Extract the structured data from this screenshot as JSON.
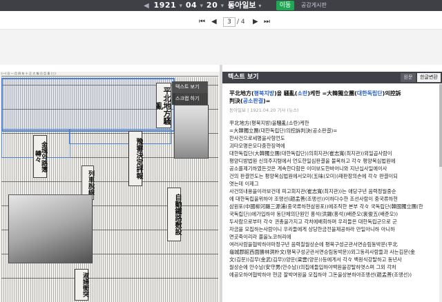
{
  "topbar": {
    "year": "1921",
    "month": "04",
    "day": "20",
    "prev_arrow": "◀",
    "next_arrow": "▶",
    "paper_name": "동아일보",
    "paper_caret": "▾",
    "go_label": "이동",
    "board_label": "공감게시판"
  },
  "pager": {
    "first": "⏮",
    "prev": "◀",
    "current": "3",
    "total": "/ 4",
    "next": "▶",
    "last": "⏭"
  },
  "scan": {
    "masthead": "(一)    日    一    月    四    年    十    正    大        報    日    亞    東        (三)",
    "headline_main": "平北地方騷亂",
    "headline_sub": "金塊와路簿轉々",
    "headline_2": "豫審決定評報",
    "headline_3": "列車脫線",
    "headline_4": "自動鐵路敷設",
    "headline_5": "淑婦衝突",
    "popup_text_view": "텍스트 보기",
    "popup_scrap": "스크랩 하기"
  },
  "textpanel": {
    "header_title": "텍스트 보기",
    "tab_original": "원문",
    "tab_hangul": "한글변환",
    "title_pre": "平北地方(",
    "title_link1": "평북지방",
    "title_mid1": ")을 騷亂(",
    "title_link2": "소란",
    "title_mid2": ")케한 =大韓獨立團(",
    "title_link3": "대한독립단",
    "title_mid3": ")의控訴",
    "title_line2_pre": "判決(",
    "title_link4": "공소판결",
    "title_post": ")=",
    "meta": "동아일보 | 1921.04.20 기사 (뉴스)",
    "body": "平北地方(평북지방)을騷亂(소란)케한\n=大韓獨立團(대한독립단)의控訴判決(공소판결)=\n한사건으로세명을사형언도\n괴타오명은모다중한징역에\n대한독립단(大韓獨立團(대한독립단))의회지관(崔志寬(최지관))외일곱사람이\n평양디방법원 신의주지텽에서 언도한일심판결을 불복하고 각々 평양복심법원에\n공소를제기하였든것은 계속한다함은 이미보도한바어니와 지난십사일에이사\n건의 판결언도는 평양복심법원에서오미(五味(오미))재판장의손에 각々 판결이되\n엿는데 이제그\n사건의내용을이라보건데 피고회지관(崔志寬(최지관))는 애당구년 음력정월중순\n에 대한독립을위하야 조맹선(趙孟善(조맹선))이하다수한 조선사람이 중국류하현\n삼원포(中國柳河縣三源浦(중국류하현삼원포))에조직한 본부 각々 국독립단(韓國獨立團(한\n국독립단))에가입하야 동단체의단원인 홍석(洪錫(홍석))배준오(裵俊五(배준오))\n두사람으로부터 각々 권총을가지고 각처에배회하며 우리들은 대한독립군으로 군\n자금을 모집하는사람이니 우리들에게 상당한금전을제공하라 만일아니하 아니하\n면곳죽이리라 볼을노코허리에\n여러사람을협박하야마정구년 음력칠월상순에 평북구성군관서면승림동박문(平北\n龜城郡館西面勝林洞朴文(평북구성군관서면승림동박문))외그동리사람들과 사는김문(金\n文(김문))김무(金武(김무))양운(梁雲(양운))등에게서 각々 백원식강탈하고 동년사\n월상순에 안수남(安守男(안수남))의집에들입하야백원을강탈하엿스며 그외 각처\n에공모하여협박하야 현금 잘박여원을 모집하야 그돈을상분하야조맹선(趙孟善(조맹선))"
  }
}
